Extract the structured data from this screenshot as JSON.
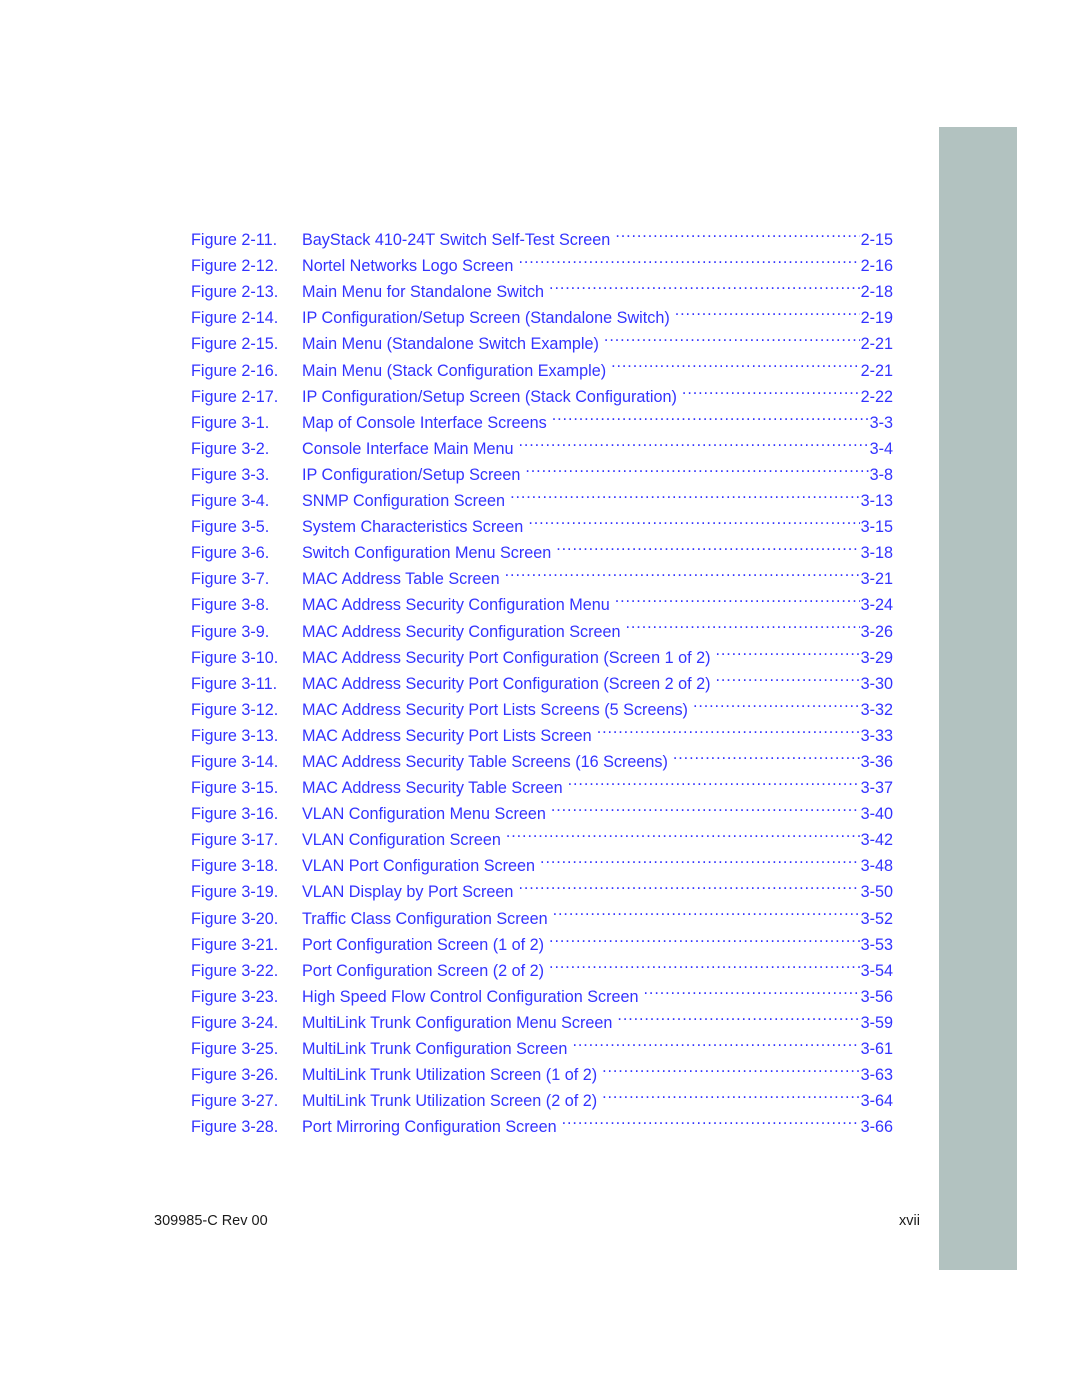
{
  "document": {
    "section_type": "list-of-figures",
    "text_color": "#3333ff",
    "edge_bar_color": "#b2c2c0",
    "footer_color": "#1a1a1a"
  },
  "figures": [
    {
      "label": "Figure 2-11.",
      "title": "BayStack 410-24T Switch Self-Test Screen",
      "page": "2-15"
    },
    {
      "label": "Figure 2-12.",
      "title": "Nortel Networks Logo Screen",
      "page": "2-16"
    },
    {
      "label": "Figure 2-13.",
      "title": "Main Menu for Standalone Switch",
      "page": "2-18"
    },
    {
      "label": "Figure 2-14.",
      "title": "IP Configuration/Setup Screen (Standalone Switch)",
      "page": "2-19"
    },
    {
      "label": "Figure 2-15.",
      "title": "Main Menu (Standalone Switch Example)",
      "page": "2-21"
    },
    {
      "label": "Figure 2-16.",
      "title": "Main Menu (Stack Configuration Example)",
      "page": "2-21"
    },
    {
      "label": "Figure 2-17.",
      "title": "IP Configuration/Setup Screen (Stack Configuration)",
      "page": "2-22"
    },
    {
      "label": "Figure 3-1.",
      "title": "Map of Console Interface Screens",
      "page": "3-3"
    },
    {
      "label": "Figure 3-2.",
      "title": "Console Interface Main Menu",
      "page": "3-4"
    },
    {
      "label": "Figure 3-3.",
      "title": "IP Configuration/Setup Screen",
      "page": "3-8"
    },
    {
      "label": "Figure 3-4.",
      "title": "SNMP Configuration Screen",
      "page": "3-13"
    },
    {
      "label": "Figure 3-5.",
      "title": "System Characteristics Screen",
      "page": "3-15"
    },
    {
      "label": "Figure 3-6.",
      "title": "Switch Configuration Menu Screen",
      "page": "3-18"
    },
    {
      "label": "Figure 3-7.",
      "title": "MAC Address Table Screen",
      "page": "3-21"
    },
    {
      "label": "Figure 3-8.",
      "title": "MAC Address Security Configuration Menu",
      "page": "3-24"
    },
    {
      "label": "Figure 3-9.",
      "title": "MAC Address Security Configuration Screen",
      "page": "3-26"
    },
    {
      "label": "Figure 3-10.",
      "title": "MAC Address Security Port Configuration (Screen 1 of 2)",
      "page": "3-29"
    },
    {
      "label": "Figure 3-11.",
      "title": "MAC Address Security Port Configuration (Screen 2 of 2)",
      "page": "3-30"
    },
    {
      "label": "Figure 3-12.",
      "title": "MAC Address Security Port Lists Screens (5 Screens)",
      "page": "3-32"
    },
    {
      "label": "Figure 3-13.",
      "title": "MAC Address Security Port Lists Screen",
      "page": "3-33"
    },
    {
      "label": "Figure 3-14.",
      "title": "MAC Address Security Table Screens (16 Screens)",
      "page": "3-36"
    },
    {
      "label": "Figure 3-15.",
      "title": "MAC Address Security Table Screen",
      "page": "3-37"
    },
    {
      "label": "Figure 3-16.",
      "title": "VLAN Configuration Menu Screen",
      "page": "3-40"
    },
    {
      "label": "Figure 3-17.",
      "title": "VLAN Configuration Screen",
      "page": "3-42"
    },
    {
      "label": "Figure 3-18.",
      "title": "VLAN Port Configuration Screen",
      "page": "3-48"
    },
    {
      "label": "Figure 3-19.",
      "title": "VLAN Display by Port Screen",
      "page": "3-50"
    },
    {
      "label": "Figure 3-20.",
      "title": "Traffic Class Configuration Screen",
      "page": "3-52"
    },
    {
      "label": "Figure 3-21.",
      "title": "Port Configuration Screen (1 of 2)",
      "page": "3-53"
    },
    {
      "label": "Figure 3-22.",
      "title": "Port Configuration Screen (2 of 2)",
      "page": "3-54"
    },
    {
      "label": "Figure 3-23.",
      "title": "High Speed Flow Control Configuration Screen",
      "page": "3-56"
    },
    {
      "label": "Figure 3-24.",
      "title": "MultiLink Trunk Configuration Menu Screen",
      "page": "3-59"
    },
    {
      "label": "Figure 3-25.",
      "title": "MultiLink Trunk Configuration Screen",
      "page": "3-61"
    },
    {
      "label": "Figure 3-26.",
      "title": "MultiLink Trunk Utilization Screen (1 of 2)",
      "page": "3-63"
    },
    {
      "label": "Figure 3-27.",
      "title": "MultiLink Trunk Utilization Screen (2 of 2)",
      "page": "3-64"
    },
    {
      "label": "Figure 3-28.",
      "title": "Port Mirroring Configuration Screen",
      "page": "3-66"
    }
  ],
  "footer": {
    "document_id": "309985-C Rev 00",
    "folio": "xvii"
  }
}
